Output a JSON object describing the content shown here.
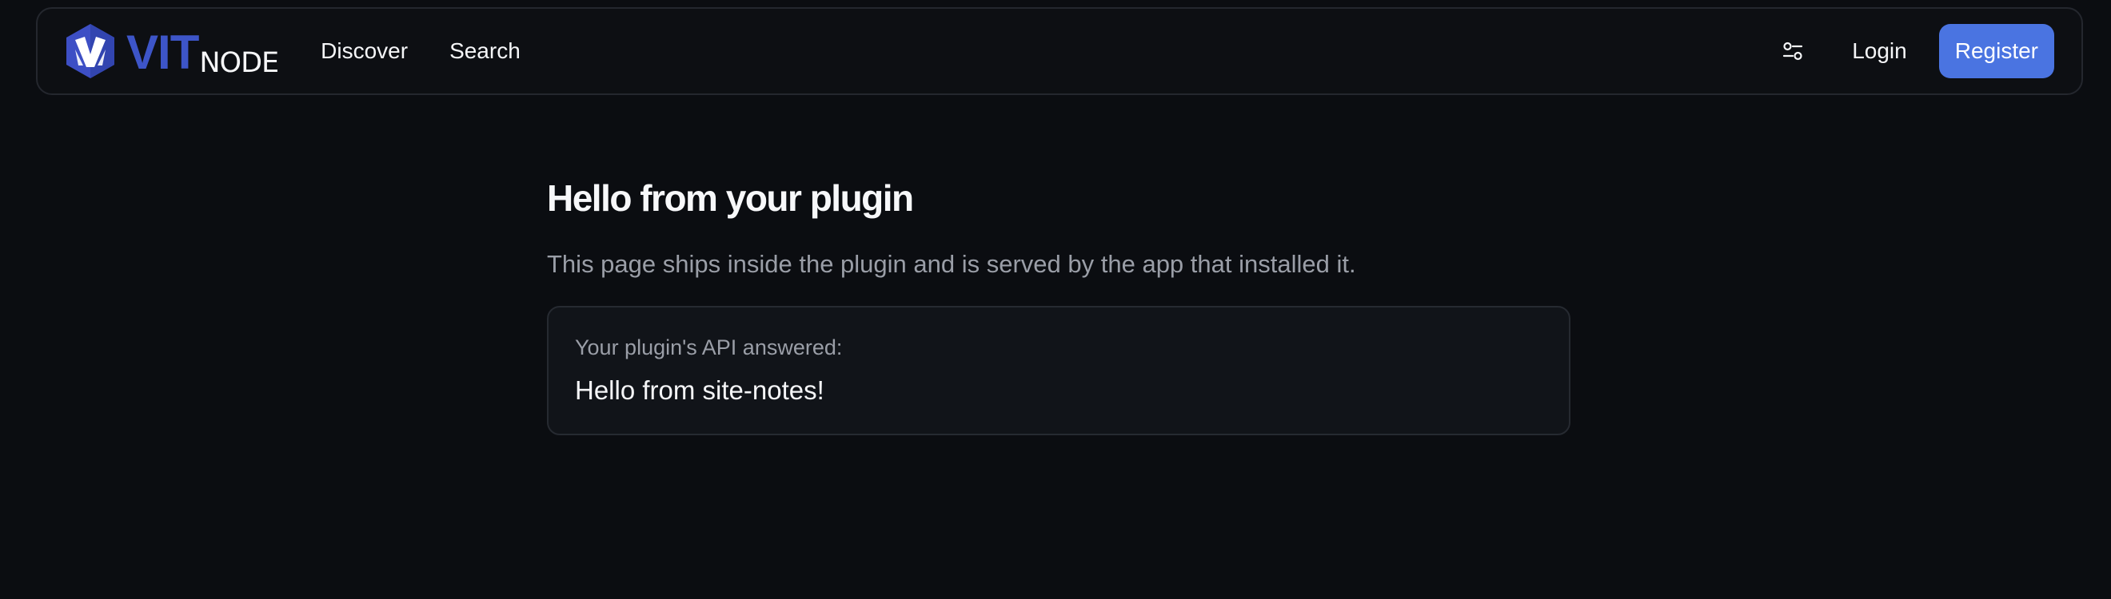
{
  "brand": {
    "name_primary": "VIT",
    "name_secondary": "NODE",
    "color_primary": "#3d55c8",
    "color_mark": "#3d4fc5"
  },
  "nav": {
    "items": [
      {
        "label": "Discover"
      },
      {
        "label": "Search"
      }
    ]
  },
  "header_actions": {
    "settings_icon": "sliders-icon",
    "login_label": "Login",
    "register_label": "Register",
    "register_color": "#4a74e1"
  },
  "main": {
    "title": "Hello from your plugin",
    "description": "This page ships inside the plugin and is served by the app that installed it.",
    "card": {
      "label": "Your plugin's API answered:",
      "value": "Hello from site-notes!"
    }
  }
}
